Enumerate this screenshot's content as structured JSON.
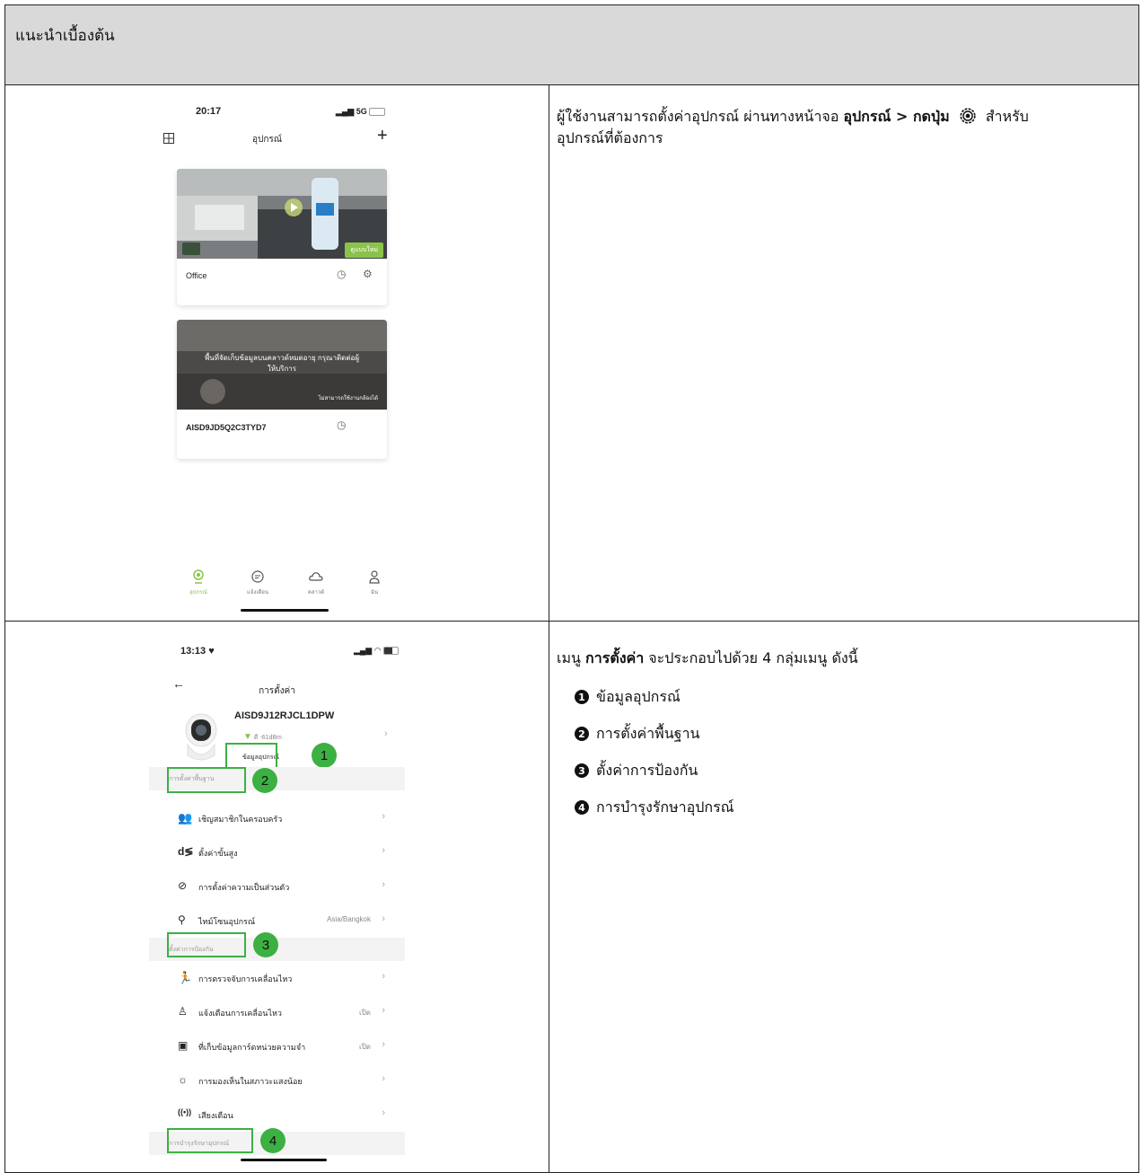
{
  "header": {
    "title": "แนะนำเบื้องต้น"
  },
  "row1": {
    "instruction": {
      "part1": "ผู้ใช้งานสามารถตั้งค่าอุปกรณ์ ผ่านทางหน้าจอ ",
      "bold": "อุปกรณ์ > กดปุ่ม",
      "part2": " สำหรับ",
      "line2": "อุปกรณ์ที่ต้องการ"
    },
    "phone": {
      "time": "20:17",
      "signal": "5G",
      "title": "อุปกรณ์",
      "card1": {
        "name": "Office",
        "badge": "ดูแบบใหม่"
      },
      "card2": {
        "name": "AISD9JD5Q2C3TYD7",
        "overlay_line1": "พื้นที่จัดเก็บข้อมูลบนคลาวด์หมดอายุ กรุณาติดต่อผู้",
        "overlay_line2": "ให้บริการ",
        "status": "ไม่สามารถใช้งานกล้องได้"
      },
      "tabs": [
        {
          "label": "อุปกรณ์",
          "icon": "camera-icon"
        },
        {
          "label": "แจ้งเตือน",
          "icon": "message-icon"
        },
        {
          "label": "คลาวด์",
          "icon": "cloud-icon"
        },
        {
          "label": "ฉัน",
          "icon": "user-icon"
        }
      ],
      "active_color": "#8bc34a"
    }
  },
  "row2": {
    "intro": {
      "part1": "เมนู ",
      "bold": "การตั้งค่า",
      "part2": " จะประกอบไปด้วย 4 กลุ่มเมนู ดังนี้"
    },
    "items": [
      {
        "marker": "1",
        "text": "ข้อมูลอุปกรณ์"
      },
      {
        "marker": "2",
        "text": "การตั้งค่าพื้นฐาน"
      },
      {
        "marker": "3",
        "text": "ตั้งค่าการป้องกัน"
      },
      {
        "marker": "4",
        "text": "การบำรุงรักษาอุปกรณ์"
      }
    ],
    "phone": {
      "time": "13:13",
      "title": "การตั้งค่า",
      "device_name": "AISD9J12RJCL1DPW",
      "signal_text": "ดี -61dBm",
      "device_info": "ข้อมูลอุปกรณ์",
      "sections": {
        "basic": "การตั้งค่าพื้นฐาน",
        "protection": "ตั้งค่าการป้องกัน",
        "maintenance": "การบำรุงรักษาอุปกรณ์"
      },
      "rows": [
        {
          "label": "เชิญสมาชิกในครอบครัว",
          "value": ""
        },
        {
          "label": "ตั้งค่าขั้นสูง",
          "value": ""
        },
        {
          "label": "การตั้งค่าความเป็นส่วนตัว",
          "value": ""
        },
        {
          "label": "ไทม์โซนอุปกรณ์",
          "value": "Asia/Bangkok"
        },
        {
          "label": "การตรวจจับการเคลื่อนไหว",
          "value": ""
        },
        {
          "label": "แจ้งเตือนการเคลื่อนไหว",
          "value": "เปิด"
        },
        {
          "label": "ที่เก็บข้อมูลการ์ดหน่วยความจำ",
          "value": "เปิด"
        },
        {
          "label": "การมองเห็นในสภาวะแสงน้อย",
          "value": ""
        },
        {
          "label": "เสียงเตือน",
          "value": ""
        }
      ],
      "callouts": [
        "1",
        "2",
        "3",
        "4"
      ],
      "highlight_color": "#3cb043"
    }
  }
}
